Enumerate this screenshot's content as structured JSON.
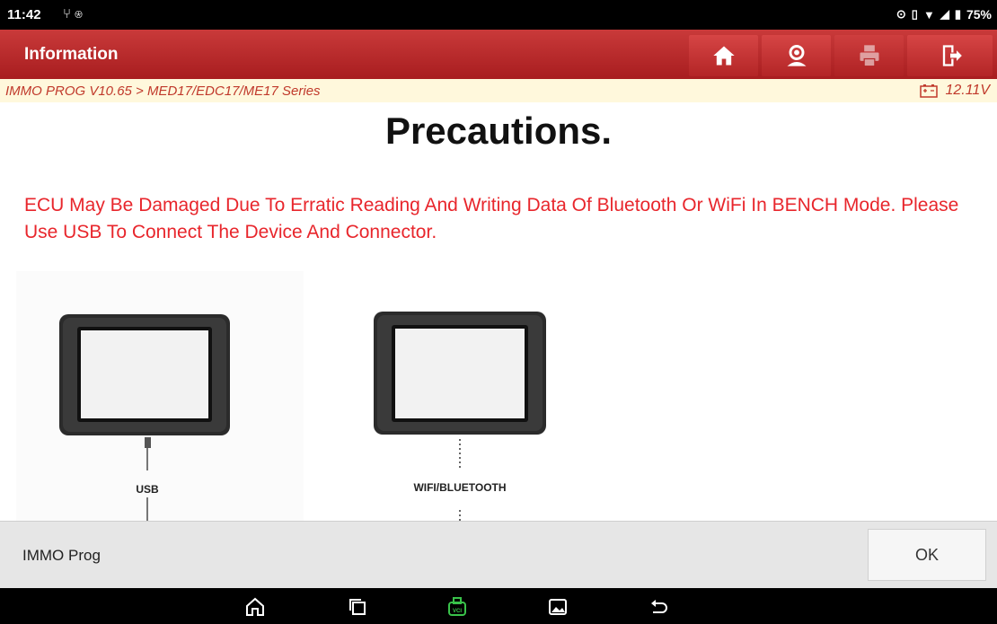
{
  "status_bar": {
    "time": "11:42",
    "left_icons": [
      "usb-icon",
      "bluetooth-icon"
    ],
    "right_icons": [
      "location-icon",
      "vibrate-icon",
      "wifi-icon",
      "signal-icon",
      "battery-icon"
    ],
    "battery": "75%"
  },
  "header": {
    "title": "Information",
    "buttons": [
      "home-icon",
      "support-icon",
      "print-icon",
      "exit-icon"
    ]
  },
  "breadcrumb": {
    "path": "IMMO PROG V10.65 > MED17/EDC17/ME17 Series",
    "voltage": "12.11V"
  },
  "main": {
    "heading": "Precautions.",
    "warning": "ECU May Be Damaged Due To Erratic Reading And Writing Data Of Bluetooth Or WiFi In BENCH Mode. Please Use USB To Connect The Device And Connector.",
    "illustration": {
      "left_label": "USB",
      "right_label": "WIFI/BLUETOOTH"
    }
  },
  "footer": {
    "app_name": "IMMO Prog",
    "ok_label": "OK"
  },
  "nav_bar": {
    "buttons": [
      "home-icon",
      "recents-icon",
      "vci-icon",
      "gallery-icon",
      "back-icon"
    ],
    "vci_label": "VCI"
  },
  "colors": {
    "header_red": "#b32526",
    "warning_red": "#e8262c",
    "breadcrumb_bg": "#fff8dc",
    "vci_green": "#39c24a"
  }
}
